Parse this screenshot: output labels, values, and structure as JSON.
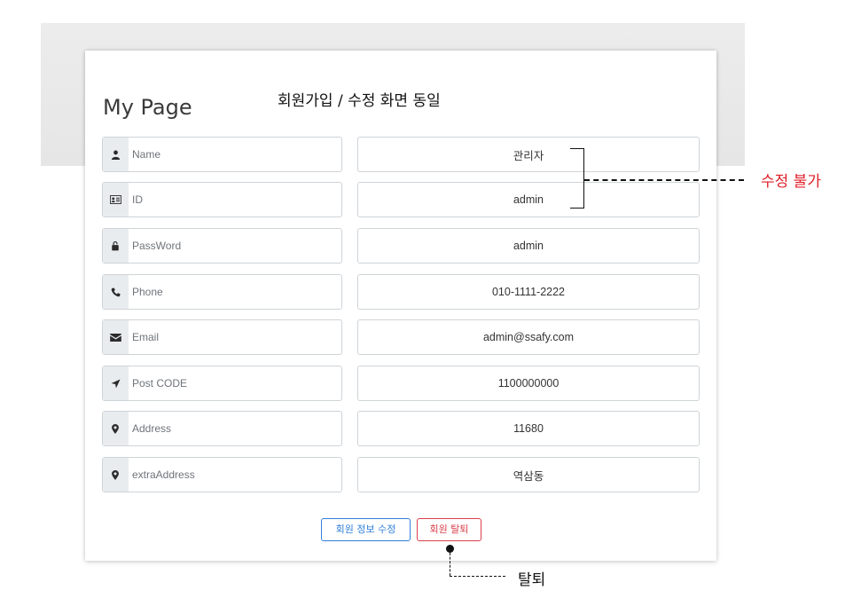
{
  "page": {
    "title": "My Page",
    "annotation_top": "회원가입 / 수정 화면 동일",
    "annotation_right": "수정 불가",
    "annotation_bottom": "탈퇴"
  },
  "fields": [
    {
      "icon": "user-icon",
      "label": "Name",
      "value": "관리자"
    },
    {
      "icon": "id-card-icon",
      "label": "ID",
      "value": "admin"
    },
    {
      "icon": "lock-icon",
      "label": "PassWord",
      "value": "admin"
    },
    {
      "icon": "phone-icon",
      "label": "Phone",
      "value": "010-1111-2222"
    },
    {
      "icon": "envelope-icon",
      "label": "Email",
      "value": "admin@ssafy.com"
    },
    {
      "icon": "location-arrow-icon",
      "label": "Post CODE",
      "value": "1100000000"
    },
    {
      "icon": "map-marker-icon",
      "label": "Address",
      "value": "11680"
    },
    {
      "icon": "map-marker-icon",
      "label": "extraAddress",
      "value": "역삼동"
    }
  ],
  "buttons": {
    "edit_label": "회원 정보 수정",
    "leave_label": "회원 탈퇴"
  },
  "colors": {
    "primary": "#2f7fd8",
    "danger": "#d9404b",
    "annotation_red": "#e0202a"
  }
}
